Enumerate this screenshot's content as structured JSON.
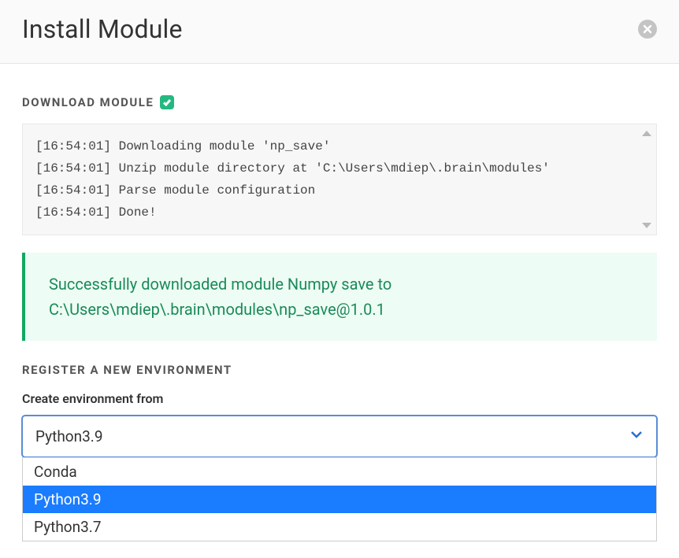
{
  "modal": {
    "title": "Install Module"
  },
  "download": {
    "heading": "DOWNLOAD MODULE",
    "log_lines": [
      "[16:54:01] Downloading module 'np_save'",
      "[16:54:01] Unzip module directory at 'C:\\Users\\mdiep\\.brain\\modules'",
      "[16:54:01] Parse module configuration",
      "[16:54:01] Done!"
    ],
    "success_message": "Successfully downloaded module Numpy save to C:\\Users\\mdiep\\.brain\\modules\\np_save@1.0.1"
  },
  "register": {
    "heading": "REGISTER A NEW ENVIRONMENT",
    "field_label": "Create environment from",
    "selected": "Python3.9",
    "options": [
      "Conda",
      "Python3.9",
      "Python3.7"
    ],
    "highlighted_index": 1
  }
}
